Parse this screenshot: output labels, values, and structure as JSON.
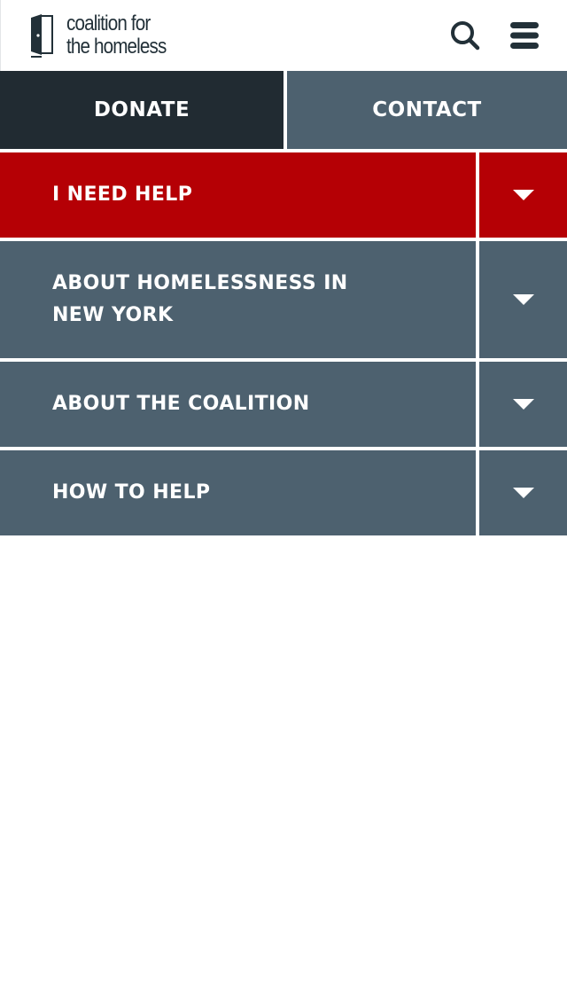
{
  "header": {
    "logo_line1": "coalition for",
    "logo_line2": "the homeless",
    "search_icon": "search-icon",
    "menu_icon": "hamburger-menu-icon"
  },
  "cta": {
    "donate_label": "DONATE",
    "contact_label": "CONTACT"
  },
  "nav": {
    "items": [
      {
        "label": "I NEED HELP",
        "state": "active",
        "toggle_icon": "caret-down-icon"
      },
      {
        "label": "ABOUT HOMELESSNESS IN NEW YORK",
        "state": "default",
        "toggle_icon": "caret-down-icon"
      },
      {
        "label": "ABOUT THE COALITION",
        "state": "default",
        "toggle_icon": "caret-down-icon"
      },
      {
        "label": "HOW TO HELP",
        "state": "default",
        "toggle_icon": "caret-down-icon"
      }
    ]
  },
  "colors": {
    "active_red": "#b50005",
    "slate": "#4d616f",
    "dark": "#212b32",
    "text_dark": "#223038",
    "white": "#ffffff"
  }
}
